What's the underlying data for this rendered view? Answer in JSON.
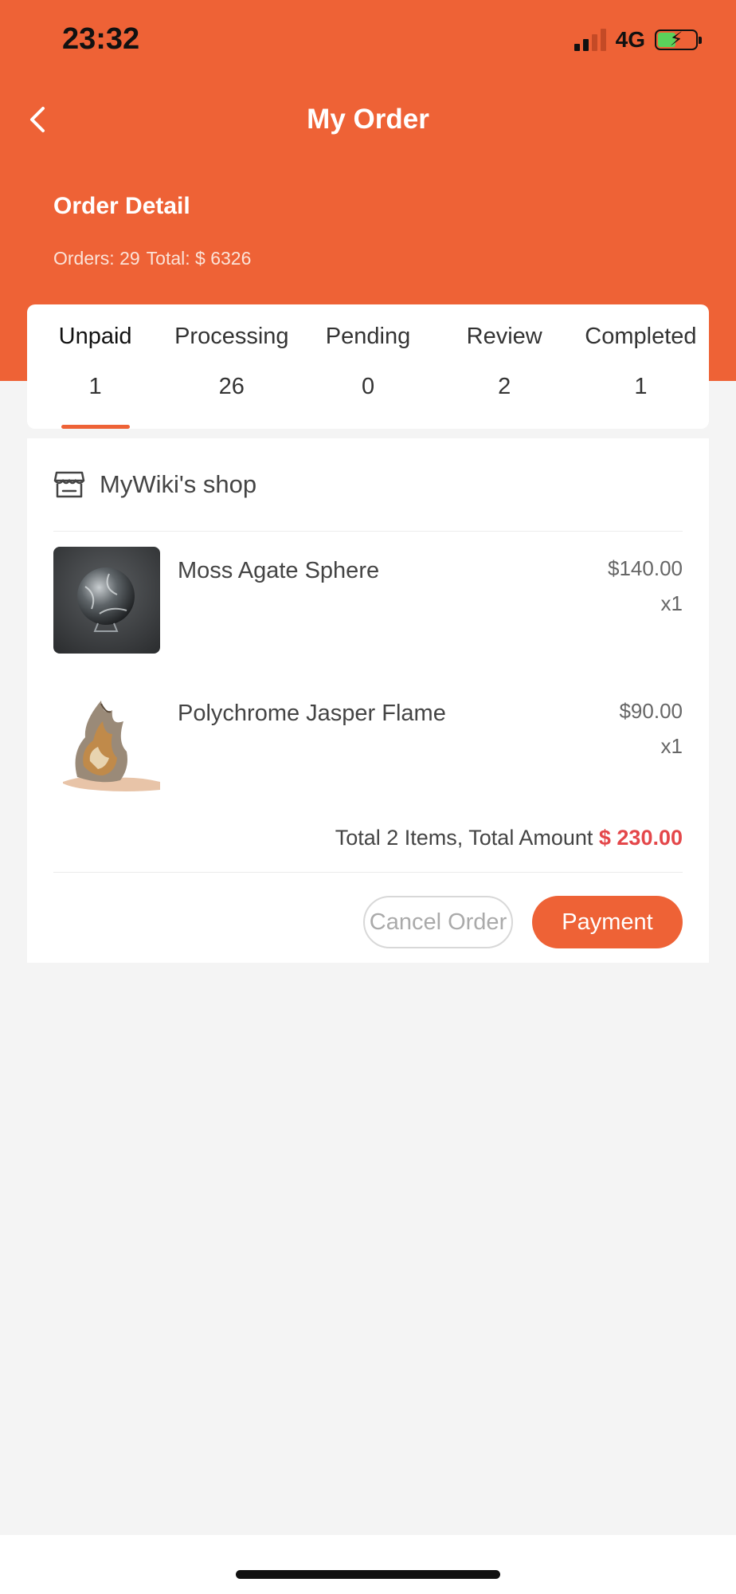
{
  "status_bar": {
    "time": "23:32",
    "network": "4G",
    "icons": [
      "signal-icon",
      "battery-charging-icon"
    ]
  },
  "nav": {
    "title": "My Order",
    "back_icon": "chevron-left-icon"
  },
  "summary": {
    "title": "Order Detail",
    "orders_text": "Orders: 29",
    "total_text": "Total: $ 6326"
  },
  "tabs": [
    {
      "label": "Unpaid",
      "count": "1",
      "active": true
    },
    {
      "label": "Processing",
      "count": "26",
      "active": false
    },
    {
      "label": "Pending",
      "count": "0",
      "active": false
    },
    {
      "label": "Review",
      "count": "2",
      "active": false
    },
    {
      "label": "Completed",
      "count": "1",
      "active": false
    }
  ],
  "order": {
    "shop_icon": "store-icon",
    "shop_name": "MyWiki's shop",
    "items": [
      {
        "name": "Moss Agate Sphere",
        "price": "$140.00",
        "qty": "x1"
      },
      {
        "name": "Polychrome Jasper Flame",
        "price": "$90.00",
        "qty": "x1"
      }
    ],
    "total_label": "Total 2 Items, Total Amount",
    "total_amount": "$ 230.00",
    "cancel_label": "Cancel Order",
    "pay_label": "Payment"
  },
  "colors": {
    "brand": "#ee6236",
    "price_accent": "#e4474a",
    "background": "#f4f4f4"
  }
}
